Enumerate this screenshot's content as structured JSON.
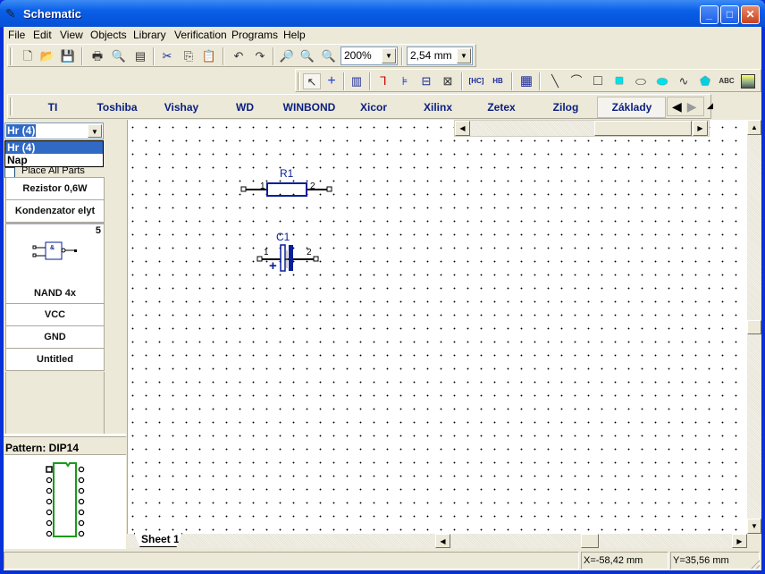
{
  "window": {
    "title": "Schematic"
  },
  "menu": [
    "File",
    "Edit",
    "View",
    "Objects",
    "Library",
    "Verification",
    "Programs",
    "Help"
  ],
  "toolbar": {
    "zoom": "200%",
    "grid": "2,54 mm"
  },
  "library_tabs": [
    "TI",
    "Toshiba",
    "Vishay",
    "WD",
    "WINBOND",
    "Xicor",
    "Xilinx",
    "Zetex",
    "Zilog",
    "Základy"
  ],
  "selected_tab": "Základy",
  "left": {
    "combo_value": "Hr (4)",
    "dropdown_options": [
      "Hr (4)",
      "Nap"
    ],
    "place_all": "Place All Parts",
    "parts": [
      "Rezistor 0,6W",
      "Kondenzator elyt",
      "NAND 4x",
      "VCC",
      "GND",
      "Untitled"
    ],
    "nand_count": "5",
    "pattern_label": "Pattern: DIP14"
  },
  "schematic": {
    "r1": {
      "ref": "R1",
      "pin1": "1",
      "pin2": "2"
    },
    "c1": {
      "ref": "C1",
      "pin1": "1",
      "pin2": "2",
      "polarity": "+"
    }
  },
  "sheet_tab": "Sheet 1",
  "status": {
    "x": "X=-58,42 mm",
    "y": "Y=35,56 mm"
  },
  "colors": {
    "symbol": "#0a1e96",
    "pattern_outline": "#1a9a1a",
    "selection": "#316ac5"
  }
}
